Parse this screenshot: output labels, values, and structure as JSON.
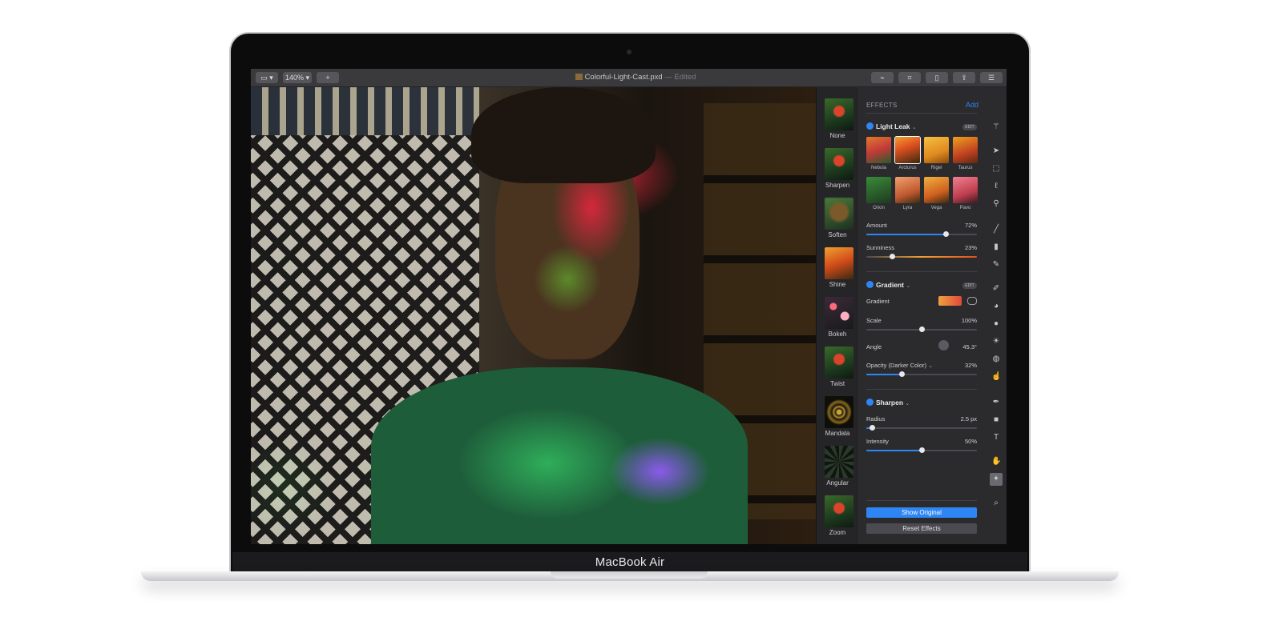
{
  "device": {
    "brand": "MacBook Air"
  },
  "titlebar": {
    "view_button": "▭ ▾",
    "zoom": "140%",
    "add_button": "+",
    "document_title": "Colorful-Light-Cast.pxd",
    "document_status": "— Edited",
    "toolbar_icons": [
      "brush-icon",
      "crop-icon",
      "document-icon",
      "share-icon",
      "adjust-icon"
    ]
  },
  "effects_presets": [
    {
      "label": "None"
    },
    {
      "label": "Sharpen"
    },
    {
      "label": "Soften"
    },
    {
      "label": "Shine"
    },
    {
      "label": "Bokeh"
    },
    {
      "label": "Twist"
    },
    {
      "label": "Mandala"
    },
    {
      "label": "Angular"
    },
    {
      "label": "Zoom"
    }
  ],
  "effects": {
    "heading": "EFFECTS",
    "add_label": "Add",
    "light_leak": {
      "title": "Light Leak",
      "edit_label": "EDIT",
      "presets_row1": [
        "Nebula",
        "Arcturus",
        "Rigel",
        "Taurus"
      ],
      "presets_row2": [
        "Orion",
        "Lyra",
        "Vega",
        "Pavo"
      ],
      "amount_label": "Amount",
      "amount_value": "72%",
      "amount_fraction": 0.72,
      "sunniness_label": "Sunniness",
      "sunniness_value": "23%",
      "sunniness_fraction": 0.23
    },
    "gradient": {
      "title": "Gradient",
      "edit_label": "EDIT",
      "gradient_label": "Gradient",
      "scale_label": "Scale",
      "scale_value": "100%",
      "scale_fraction": 0.5,
      "angle_label": "Angle",
      "angle_value": "45.3°",
      "opacity_label": "Opacity (Darker Color)",
      "opacity_value": "32%",
      "opacity_fraction": 0.32
    },
    "sharpen": {
      "title": "Sharpen",
      "radius_label": "Radius",
      "radius_value": "2.5 px",
      "radius_fraction": 0.05,
      "intensity_label": "Intensity",
      "intensity_value": "50%",
      "intensity_fraction": 0.5
    },
    "show_original": "Show Original",
    "reset_effects": "Reset Effects"
  },
  "tools": [
    "magic-wand-icon",
    "arrow-icon",
    "marquee-icon",
    "lasso-icon",
    "eyedropper-icon",
    "pen-line-icon",
    "bucket-icon",
    "pencil-icon",
    "eraser-icon",
    "clone-icon",
    "blur-icon",
    "light-icon",
    "sponge-icon",
    "smudge-icon",
    "pen-icon",
    "shape-icon",
    "text-icon",
    "hand-icon",
    "effects-icon",
    "zoom-icon"
  ],
  "colors": {
    "accent": "#2e86f5",
    "panel": "#2b2b2e",
    "titlebar": "#3a3a3d"
  }
}
